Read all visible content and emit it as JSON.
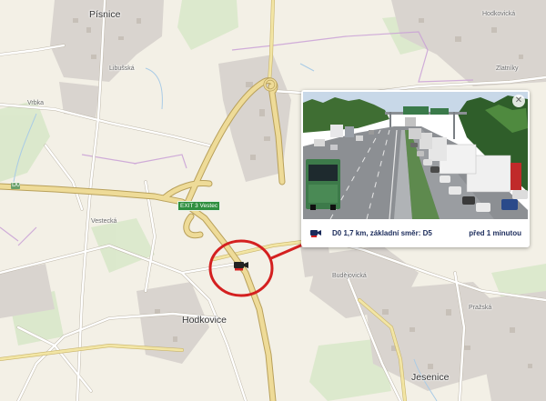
{
  "map": {
    "places": {
      "pisnice": "Písnice",
      "hodkovice": "Hodkovice",
      "jesenice": "Jesenice",
      "vestec_exit": "EXIT 3 Vestec",
      "d0": "D0",
      "vrbka": "Vrbka",
      "libusska": "Libušská",
      "vestecka": "Vestecká",
      "budejovicka": "Budějovická",
      "zlatniky": "Zlatníky",
      "hodkovicka": "Hodkovická",
      "prazska": "Pražská"
    },
    "colors": {
      "land": "#f3f0e6",
      "highway": "#e6d290",
      "highway_edge": "#bfa560",
      "urban": "#dcd6d0",
      "green": "#d7e7c7",
      "boundary": "#c49fd0",
      "water": "#a9cbe6",
      "highlight_circle": "#d42020",
      "connector": "#d42020"
    }
  },
  "popup": {
    "location": "D0 1,7 km, základní směr: D5",
    "time_ago": "před 1 minutou",
    "close_icon": "close-icon",
    "camera_icon": "traffic-camera-icon"
  }
}
